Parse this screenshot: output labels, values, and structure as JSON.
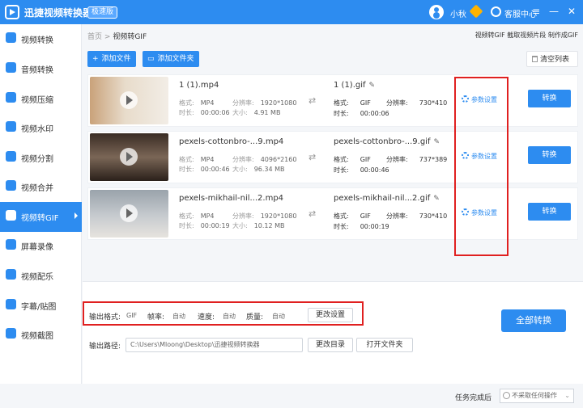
{
  "app": {
    "title": "迅捷视频转换器",
    "edition": "极速版",
    "user_name": "小秋",
    "service_label": "客服中心"
  },
  "window_controls": {
    "menu": "≡",
    "minimize": "—",
    "close": "✕"
  },
  "sidebar": {
    "items": [
      {
        "label": "视频转换"
      },
      {
        "label": "音频转换"
      },
      {
        "label": "视频压缩"
      },
      {
        "label": "视频水印"
      },
      {
        "label": "视频分割"
      },
      {
        "label": "视频合并"
      },
      {
        "label": "视频转GIF",
        "active": true
      },
      {
        "label": "屏幕录像"
      },
      {
        "label": "视频配乐"
      },
      {
        "label": "字幕/贴图"
      },
      {
        "label": "视频截图"
      }
    ]
  },
  "breadcrumb": {
    "home": "首页",
    "sep": ">",
    "current": "视频转GIF"
  },
  "top_links": {
    "a": "视频转GIF",
    "b": "截取视频片段",
    "c": "制作成GIF"
  },
  "toolbar": {
    "add_file": "添加文件",
    "add_folder": "添加文件夹",
    "clear": "清空列表"
  },
  "labels": {
    "format": "格式:",
    "resolution": "分辨率:",
    "duration": "时长:",
    "size": "大小:",
    "settings": "参数设置",
    "convert": "转换"
  },
  "files": [
    {
      "src_name": "1 (1).mp4",
      "src_format": "MP4",
      "src_res": "1920*1080",
      "src_dur": "00:00:06",
      "src_size": "4.91 MB",
      "dst_name": "1 (1).gif",
      "dst_format": "GIF",
      "dst_res": "730*410",
      "dst_dur": "00:00:06"
    },
    {
      "src_name": "pexels-cottonbro-...9.mp4",
      "src_format": "MP4",
      "src_res": "4096*2160",
      "src_dur": "00:00:46",
      "src_size": "96.34 MB",
      "dst_name": "pexels-cottonbro-...9.gif",
      "dst_format": "GIF",
      "dst_res": "737*389",
      "dst_dur": "00:00:46"
    },
    {
      "src_name": "pexels-mikhail-nil...2.mp4",
      "src_format": "MP4",
      "src_res": "1920*1080",
      "src_dur": "00:00:19",
      "src_size": "10.12 MB",
      "dst_name": "pexels-mikhail-nil...2.gif",
      "dst_format": "GIF",
      "dst_res": "730*410",
      "dst_dur": "00:00:19"
    }
  ],
  "output": {
    "format_label": "输出格式:",
    "format": "GIF",
    "fps_label": "帧率:",
    "fps": "自动",
    "speed_label": "速度:",
    "speed": "自动",
    "quality_label": "质量:",
    "quality": "自动",
    "change_settings": "更改设置",
    "path_label": "输出路径:",
    "path": "C:\\Users\\Mloong\\Desktop\\迅捷视频转换器",
    "change_dir": "更改目录",
    "open_folder": "打开文件夹",
    "convert_all": "全部转换"
  },
  "status": {
    "after_label": "任务完成后",
    "after_value": "不采取任何操作"
  },
  "colors": {
    "accent": "#2d8cf0",
    "annotation": "#e02020"
  }
}
